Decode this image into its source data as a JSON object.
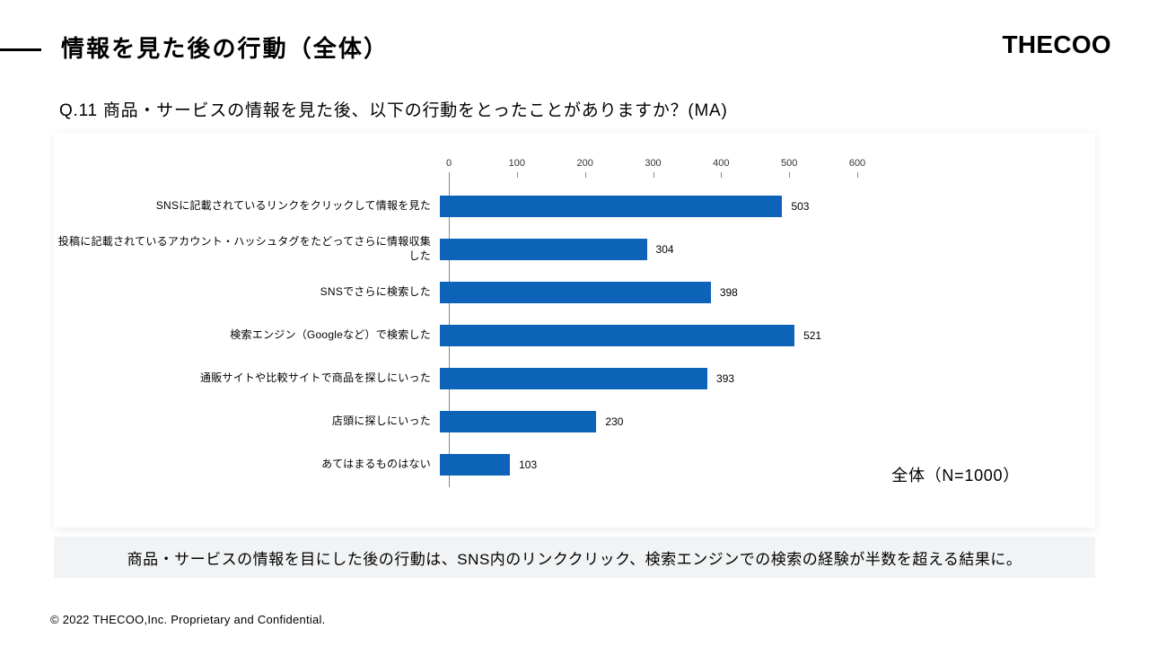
{
  "title": "情報を見た後の行動（全体）",
  "logo": "THECOO",
  "question": "Q.11 商品・サービスの情報を見た後、以下の行動をとったことがありますか？(MA)",
  "sample_note": "全体（N=1000）",
  "finding": "商品・サービスの情報を目にした後の行動は、SNS内のリンククリック、検索エンジンでの検索の経験が半数を超える結果に。",
  "footer": "© 2022 THECOO,Inc. Proprietary and Confidential.",
  "chart_data": {
    "type": "bar",
    "orientation": "horizontal",
    "xlim": [
      0,
      600
    ],
    "ticks": [
      0,
      100,
      200,
      300,
      400,
      500,
      600
    ],
    "categories": [
      "SNSに記載されているリンクをクリックして情報を見た",
      "投稿に記載されているアカウント・ハッシュタグをたどってさらに情報収集した",
      "SNSでさらに検索した",
      "検索エンジン（Googleなど）で検索した",
      "通販サイトや比較サイトで商品を探しにいった",
      "店頭に探しにいった",
      "あてはまるものはない"
    ],
    "values": [
      503,
      304,
      398,
      521,
      393,
      230,
      103
    ],
    "bar_color": "#0d63b8"
  }
}
